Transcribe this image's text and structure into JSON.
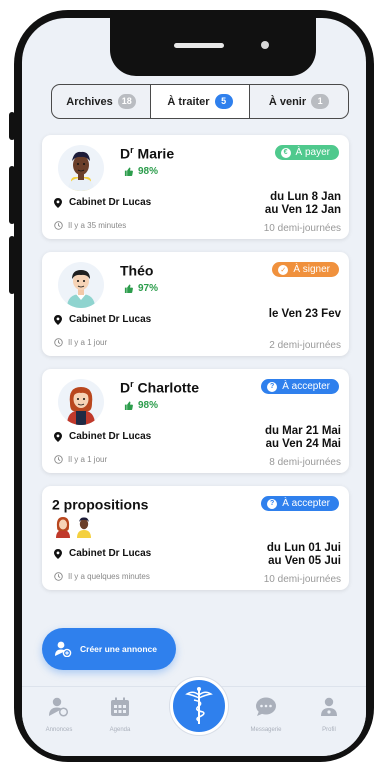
{
  "tabs": [
    {
      "label": "Archives",
      "count": "18"
    },
    {
      "label": "À traiter",
      "count": "5"
    },
    {
      "label": "À venir",
      "count": "1"
    }
  ],
  "cards": [
    {
      "title_prefix": "D",
      "title_sup": "r",
      "title": " Marie",
      "rating": "98%",
      "badge": "À payer",
      "badge_color": "#4fc98d",
      "badge_icon": "€",
      "location": "Cabinet Dr Lucas",
      "ago": "Il y a 35 minutes",
      "date_line1": "du Lun 8 Jan",
      "date_line2": "au Ven 12 Jan",
      "halfdays": "10 demi-journées"
    },
    {
      "title_prefix": "",
      "title_sup": "",
      "title": "Théo",
      "rating": "97%",
      "badge": "À signer",
      "badge_color": "#f0913d",
      "badge_icon": "✓",
      "location": "Cabinet Dr Lucas",
      "ago": "Il y a 1 jour",
      "date_line1": "le Ven 23 Fev",
      "date_line2": "",
      "halfdays": "2 demi-journées"
    },
    {
      "title_prefix": "D",
      "title_sup": "r",
      "title": " Charlotte",
      "rating": "98%",
      "badge": "À accepter",
      "badge_color": "#2f80ed",
      "badge_icon": "?",
      "location": "Cabinet Dr Lucas",
      "ago": "Il y a 1 jour",
      "date_line1": "du Mar 21 Mai",
      "date_line2": "au Ven 24 Mai",
      "halfdays": "8 demi-journées"
    },
    {
      "title_prefix": "",
      "title_sup": "",
      "title": "2 propositions",
      "rating": "",
      "badge": "À accepter",
      "badge_color": "#2f80ed",
      "badge_icon": "?",
      "location": "Cabinet Dr Lucas",
      "ago": "Il y a quelques minutes",
      "date_line1": "du Lun 01 Jui",
      "date_line2": "au Ven 05 Jui",
      "halfdays": "10 demi-journées"
    }
  ],
  "fab_label": "Créer une annonce",
  "bottom_nav": [
    {
      "label": "Annonces",
      "icon": "annonces-icon"
    },
    {
      "label": "Agenda",
      "icon": "calendar-icon"
    },
    {
      "label": "",
      "icon": "caduceus-icon"
    },
    {
      "label": "Messagerie",
      "icon": "chat-icon"
    },
    {
      "label": "Profil",
      "icon": "profile-icon"
    }
  ],
  "colors": {
    "accent": "#2f80ed",
    "pay": "#4fc98d",
    "sign": "#f0913d",
    "rating": "#2c9d4c"
  }
}
